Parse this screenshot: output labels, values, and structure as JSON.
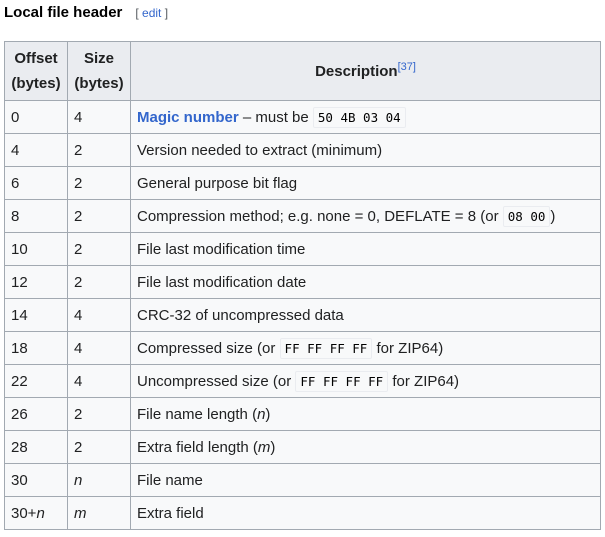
{
  "heading": {
    "title": "Local file header",
    "edit_open": "[ ",
    "edit_label": "edit",
    "edit_close": " ]"
  },
  "table": {
    "headers": {
      "offset": [
        "Offset",
        "(bytes)"
      ],
      "size": [
        "Size",
        "(bytes)"
      ],
      "description": "Description",
      "ref": "[37]"
    },
    "rows": [
      {
        "offset": "0",
        "size": "4",
        "link": "Magic number",
        "pre": " – must be ",
        "code": "50 4B 03 04",
        "post": ""
      },
      {
        "offset": "4",
        "size": "2",
        "desc": "Version needed to extract (minimum)"
      },
      {
        "offset": "6",
        "size": "2",
        "desc": "General purpose bit flag"
      },
      {
        "offset": "8",
        "size": "2",
        "pre": "Compression method; e.g. none = 0, DEFLATE = 8 (or ",
        "code": "08 00",
        "post": ")"
      },
      {
        "offset": "10",
        "size": "2",
        "desc": "File last modification time"
      },
      {
        "offset": "12",
        "size": "2",
        "desc": "File last modification date"
      },
      {
        "offset": "14",
        "size": "4",
        "desc": "CRC-32 of uncompressed data"
      },
      {
        "offset": "18",
        "size": "4",
        "pre": "Compressed size (or ",
        "code": "FF FF FF FF",
        "post": " for ZIP64)"
      },
      {
        "offset": "22",
        "size": "4",
        "pre": "Uncompressed size (or ",
        "code": "FF FF FF FF",
        "post": " for ZIP64)"
      },
      {
        "offset": "26",
        "size": "2",
        "pre": "File name length (",
        "var": "n",
        "post": ")"
      },
      {
        "offset": "28",
        "size": "2",
        "pre": "Extra field length (",
        "var": "m",
        "post": ")"
      },
      {
        "offset": "30",
        "size_var": "n",
        "desc": "File name"
      },
      {
        "offset": "30+",
        "offset_var": "n",
        "size_var": "m",
        "desc": "Extra field"
      }
    ]
  }
}
